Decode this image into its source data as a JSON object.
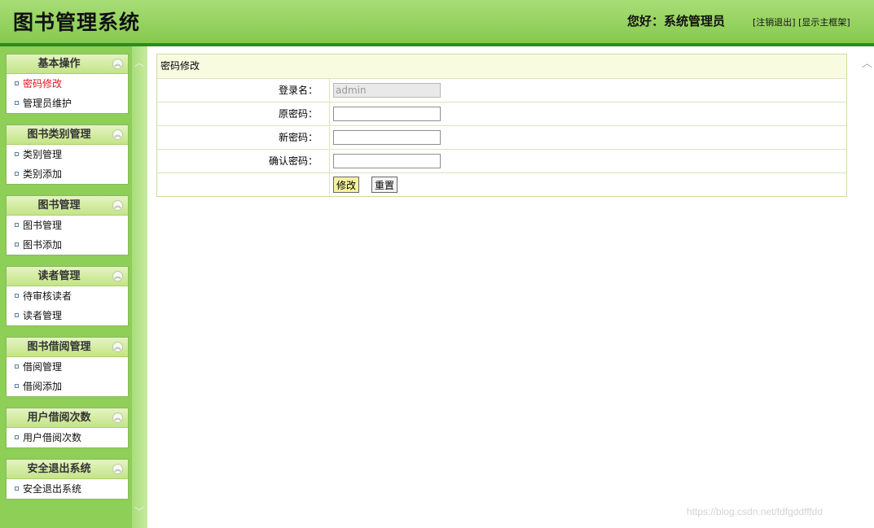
{
  "header": {
    "title": "图书管理系统",
    "greeting": "您好：系统管理员",
    "logout_link": "[注销退出]",
    "frame_link": "[显示主框架]"
  },
  "sidebar": {
    "groups": [
      {
        "title": "基本操作",
        "items": [
          "密码修改",
          "管理员维护"
        ]
      },
      {
        "title": "图书类别管理",
        "items": [
          "类别管理",
          "类别添加"
        ]
      },
      {
        "title": "图书管理",
        "items": [
          "图书管理",
          "图书添加"
        ]
      },
      {
        "title": "读者管理",
        "items": [
          "待审核读者",
          "读者管理"
        ]
      },
      {
        "title": "图书借阅管理",
        "items": [
          "借阅管理",
          "借阅添加"
        ]
      },
      {
        "title": "用户借阅次数",
        "items": [
          "用户借阅次数"
        ]
      },
      {
        "title": "安全退出系统",
        "items": [
          "安全退出系统"
        ]
      }
    ],
    "active_item": "密码修改",
    "toggle_icon": "collapse-up-icon"
  },
  "form": {
    "title": "密码修改",
    "fields": [
      {
        "label": "登录名：",
        "value": "admin",
        "disabled": true
      },
      {
        "label": "原密码：",
        "value": ""
      },
      {
        "label": "新密码：",
        "value": ""
      },
      {
        "label": "确认密码：",
        "value": ""
      }
    ],
    "submit_label": "修改",
    "reset_label": "重置"
  },
  "watermark": "https://blog.csdn.net/fdfgddfffdd",
  "colors": {
    "header_green": "#94d25f",
    "accent_line": "#2f8a1e",
    "active_link": "#e3151d"
  }
}
